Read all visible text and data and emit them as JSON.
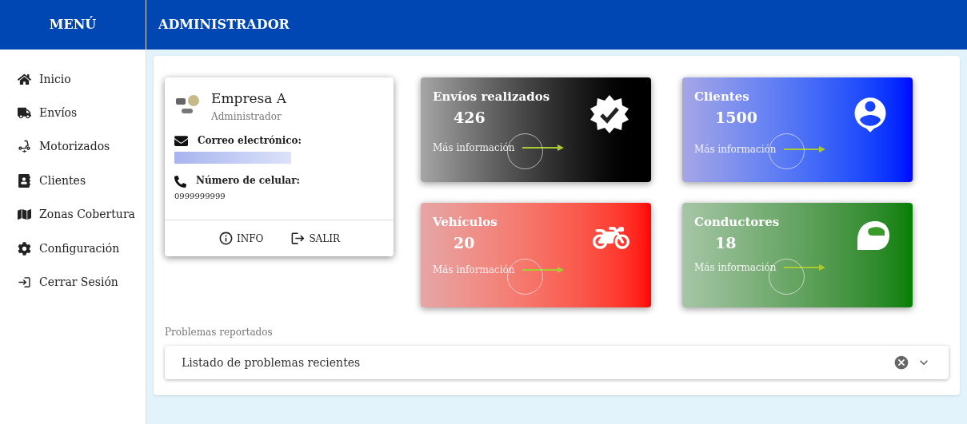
{
  "sidebar": {
    "title": "MENÚ",
    "items": [
      {
        "kind": "home",
        "label": "Inicio"
      },
      {
        "kind": "truck",
        "label": "Envíos"
      },
      {
        "kind": "scooter",
        "label": "Motorizados"
      },
      {
        "kind": "contacts",
        "label": "Clientes"
      },
      {
        "kind": "map",
        "label": "Zonas Cobertura"
      },
      {
        "kind": "gear",
        "label": "Configuración"
      },
      {
        "kind": "logout",
        "label": "Cerrar Sesión"
      }
    ]
  },
  "header": {
    "title": "ADMINISTRADOR"
  },
  "profile": {
    "name": "Empresa A",
    "role": "Administrador",
    "email_label": "Correo electrónico:",
    "phone_label": "Número de celular:",
    "phone": "0999999999",
    "actions": [
      {
        "kind": "info",
        "label": "INFO"
      },
      {
        "kind": "exit",
        "label": "SALIR"
      }
    ]
  },
  "stats": [
    {
      "kind": "badge",
      "title": "Envíos realizados",
      "value": "426",
      "link": "Más información",
      "color": "#000000"
    },
    {
      "kind": "person",
      "title": "Clientes",
      "value": "1500",
      "link": "Más información",
      "color": "#0000ff"
    },
    {
      "kind": "motorcycle",
      "title": "Vehículos",
      "value": "20",
      "link": "Más información",
      "color": "#ff0000"
    },
    {
      "kind": "helmet",
      "title": "Conductores",
      "value": "18",
      "link": "Más información",
      "color": "#008000"
    }
  ],
  "problems": {
    "label": "Problemas reportados",
    "placeholder": "Listado de problemas recientes"
  }
}
